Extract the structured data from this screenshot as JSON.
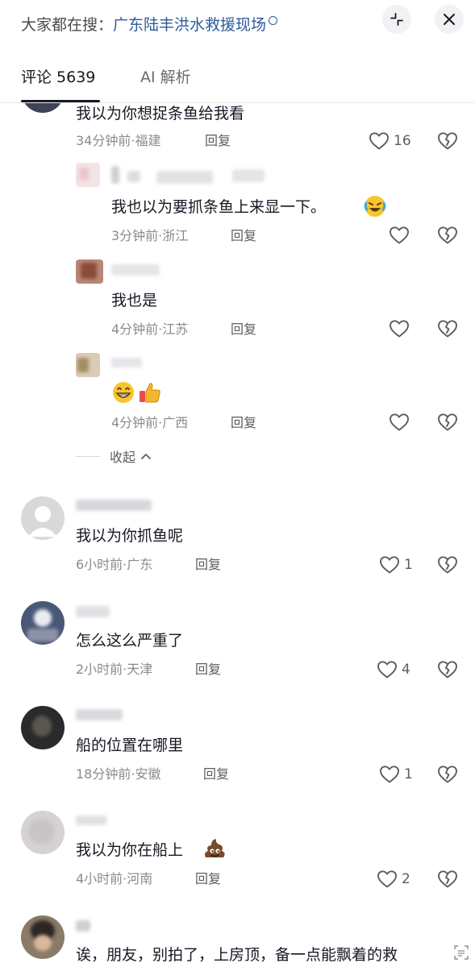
{
  "search": {
    "prefix": "大家都在搜：",
    "topic": "广东陆丰洪水救援现场",
    "search_icon": "search-icon",
    "collapse_icon": "minimize-icon",
    "close_icon": "close-icon"
  },
  "tabs": {
    "comments": "评论 5639",
    "ai": "AI 解析"
  },
  "comments": [
    {
      "text": "我以为你想捉条鱼给我看",
      "meta": "34分钟前·福建",
      "reply": "回复",
      "likes": "16",
      "replies": [
        {
          "text": "我也以为要抓条鱼上来显一下。",
          "emoji": "rolling-laughing-face",
          "meta": "3分钟前·浙江",
          "reply": "回复"
        },
        {
          "text": "我也是",
          "meta": "4分钟前·江苏",
          "reply": "回复"
        },
        {
          "text": "",
          "emoji": "grinning-face thumbs-up",
          "meta": "4分钟前·广西",
          "reply": "回复"
        }
      ],
      "collapse": "收起"
    },
    {
      "text": "我以为你抓鱼呢",
      "meta": "6小时前·广东",
      "reply": "回复",
      "likes": "1"
    },
    {
      "text": "怎么这么严重了",
      "meta": "2小时前·天津",
      "reply": "回复",
      "likes": "4"
    },
    {
      "text": "船的位置在哪里",
      "meta": "18分钟前·安徽",
      "reply": "回复",
      "likes": "1"
    },
    {
      "text": "我以为你在船上",
      "emoji": "poop-emoji",
      "meta": "4小时前·河南",
      "reply": "回复",
      "likes": "2"
    },
    {
      "text": "诶，朋友，别拍了，上房顶，备一点能飘着的救"
    }
  ],
  "colors": {
    "text": "#161823",
    "meta": "#8a8b91",
    "topic": "#2d5a9b"
  }
}
